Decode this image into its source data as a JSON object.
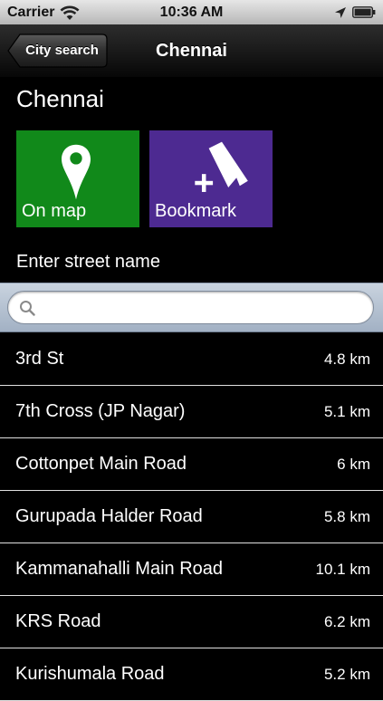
{
  "status": {
    "carrier": "Carrier",
    "time": "10:36 AM",
    "icons": [
      "wifi-icon",
      "location-arrow-icon",
      "battery-icon"
    ]
  },
  "nav": {
    "back_label": "City search",
    "title": "Chennai"
  },
  "city": {
    "title": "Chennai"
  },
  "actions": {
    "on_map": {
      "label": "On map",
      "icon": "map-pin-icon",
      "color": "#11891a"
    },
    "bookmark": {
      "label": "Bookmark",
      "icon": "bookmark-add-icon",
      "color": "#4d2a91"
    }
  },
  "street": {
    "label": "Enter street name",
    "search_value": "",
    "search_icon": "magnifier-icon"
  },
  "streets": [
    {
      "name": "3rd St",
      "distance": "4.8 km"
    },
    {
      "name": "7th Cross (JP Nagar)",
      "distance": "5.1 km"
    },
    {
      "name": "Cottonpet Main Road",
      "distance": "6 km"
    },
    {
      "name": "Gurupada Halder Road",
      "distance": "5.8 km"
    },
    {
      "name": "Kammanahalli Main Road",
      "distance": "10.1 km"
    },
    {
      "name": "KRS Road",
      "distance": "6.2 km"
    },
    {
      "name": "Kurishumala Road",
      "distance": "5.2 km"
    }
  ]
}
